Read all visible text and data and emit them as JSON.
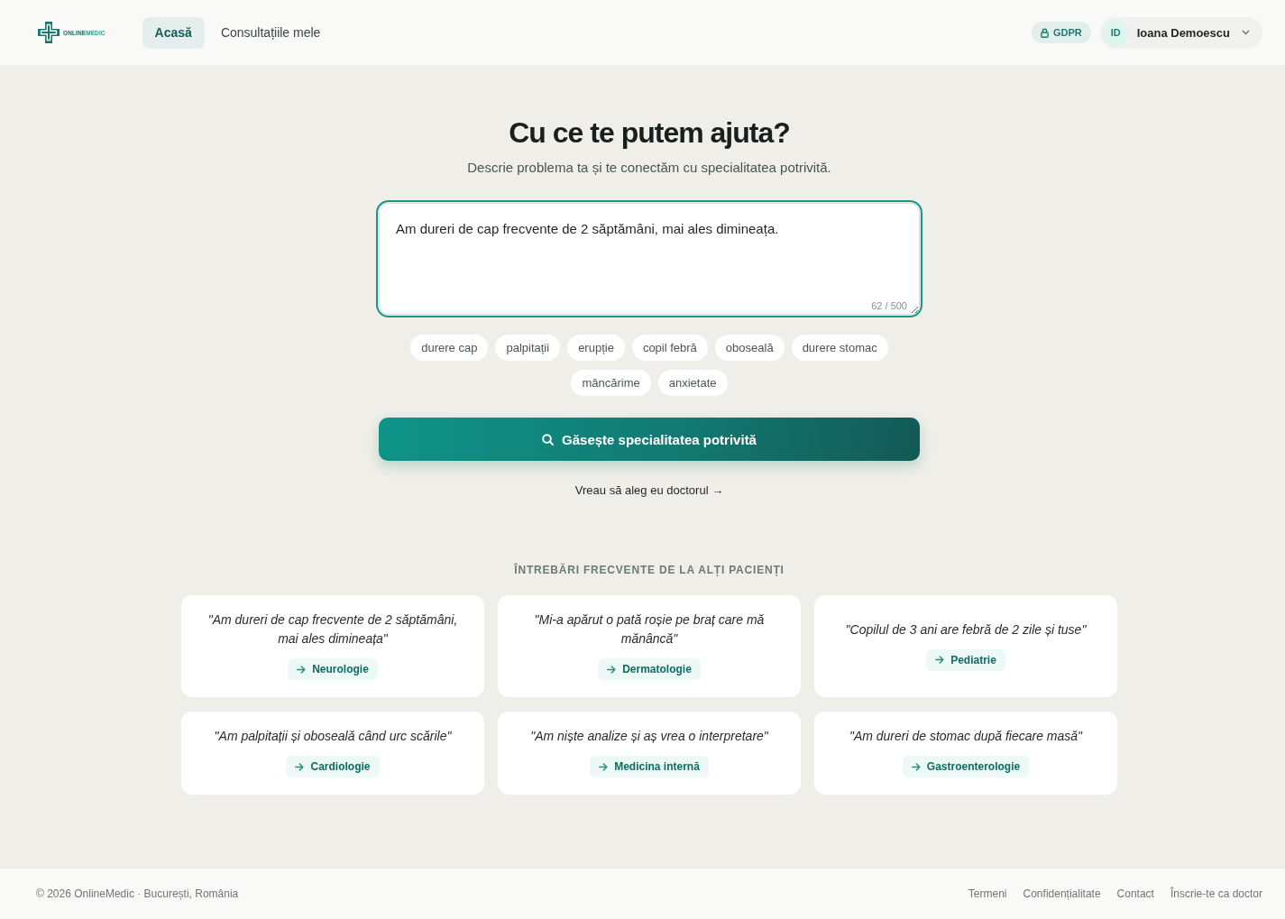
{
  "header": {
    "logo": {
      "parts": [
        "ONLINE",
        "MEDIC"
      ]
    },
    "nav": [
      {
        "label": "Acasă",
        "selected": true
      },
      {
        "label": "Consultațiile mele",
        "selected": false
      }
    ],
    "gdpr_badge": "GDPR",
    "user": {
      "initials": "ID",
      "name": "Ioana Demoescu"
    }
  },
  "hero": {
    "title": "Cu ce te putem ajuta?",
    "subtitle": "Descrie problema ta și te conectăm cu specialitatea potrivită.",
    "symptom_input": {
      "value": "Am dureri de cap frecvente de 2 săptămâni, mai ales dimineața.",
      "counter": "62 / 500"
    },
    "suggestions": [
      "durere cap",
      "palpitații",
      "erupție",
      "copil febră",
      "oboseală",
      "durere stomac",
      "mâncărime",
      "anxietate"
    ],
    "search_button": "Găsește specialitatea potrivită",
    "choose_doctor_link": "Vreau să aleg eu doctorul →"
  },
  "faq": {
    "heading": "ÎNTREBĂRI FRECVENTE DE LA ALȚI PACIENȚI",
    "cards": [
      {
        "quote": "\"Am dureri de cap frecvente de 2 săptămâni, mai ales dimineața\"",
        "specialty": "Neurologie"
      },
      {
        "quote": "\"Mi-a apărut o pată roșie pe braț care mă mănâncă\"",
        "specialty": "Dermatologie"
      },
      {
        "quote": "\"Copilul de 3 ani are febră de 2 zile și tuse\"",
        "specialty": "Pediatrie"
      },
      {
        "quote": "\"Am palpitații și oboseală când urc scările\"",
        "specialty": "Cardiologie"
      },
      {
        "quote": "\"Am niște analize și aș vrea o interpretare\"",
        "specialty": "Medicina internă"
      },
      {
        "quote": "\"Am dureri de stomac după fiecare masă\"",
        "specialty": "Gastroenterologie"
      }
    ]
  },
  "footer": {
    "copyright": "© 2026 OnlineMedic · București, România",
    "links": [
      "Termeni",
      "Confidențialitate",
      "Contact",
      "Înscrie-te ca doctor"
    ]
  }
}
